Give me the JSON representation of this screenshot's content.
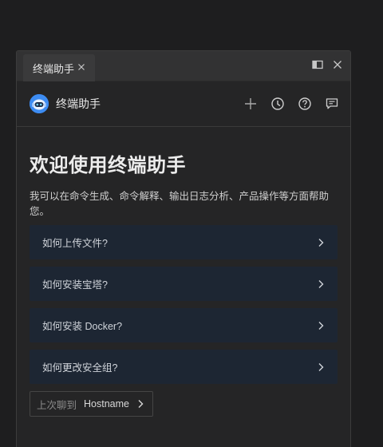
{
  "tab": {
    "label": "终端助手"
  },
  "header": {
    "title": "终端助手"
  },
  "welcome": {
    "title": "欢迎使用终端助手",
    "subtitle": "我可以在命令生成、命令解释、输出日志分析、产品操作等方面帮助您。"
  },
  "questions": [
    {
      "label": "如何上传文件?"
    },
    {
      "label": "如何安装宝塔?"
    },
    {
      "label": "如何安装 Docker?"
    },
    {
      "label": "如何更改安全组?"
    }
  ],
  "last_chat": {
    "label": "上次聊到",
    "host": "Hostname"
  },
  "icons": {
    "tab_close": "close-icon",
    "split": "split-panel-icon",
    "panel_close": "close-icon",
    "add": "plus-icon",
    "history": "clock-icon",
    "help": "help-circle-icon",
    "feedback": "message-edit-icon",
    "chevron": "chevron-right-icon"
  },
  "colors": {
    "accent": "#3d8cf2",
    "card_bg": "#1d2633"
  }
}
